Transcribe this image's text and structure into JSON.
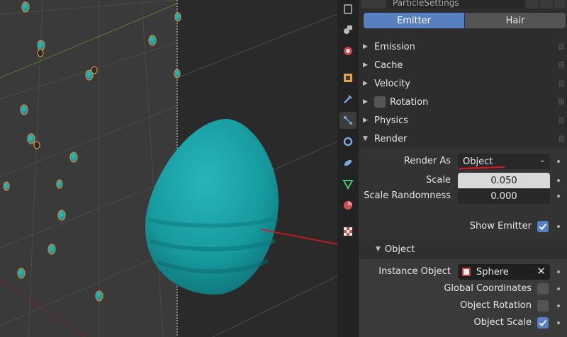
{
  "datablock": {
    "name": "ParticleSettings"
  },
  "mode_tabs": [
    {
      "label": "Emitter",
      "active": true
    },
    {
      "label": "Hair",
      "active": false
    }
  ],
  "panels": [
    {
      "label": "Emission",
      "expanded": false
    },
    {
      "label": "Cache",
      "expanded": false
    },
    {
      "label": "Velocity",
      "expanded": false
    },
    {
      "label": "Rotation",
      "expanded": false,
      "has_checkbox": true,
      "checked": false
    },
    {
      "label": "Physics",
      "expanded": false
    },
    {
      "label": "Render",
      "expanded": true
    }
  ],
  "render": {
    "render_as_label": "Render As",
    "render_as_value": "Object",
    "scale_label": "Scale",
    "scale_value": "0.050",
    "scale_random_label": "Scale Randomness",
    "scale_random_value": "0.000",
    "show_emitter_label": "Show Emitter",
    "show_emitter_checked": true
  },
  "object_subpanel": {
    "label": "Object",
    "instance_label": "Instance Object",
    "instance_value": "Sphere",
    "global_coords_label": "Global Coordinates",
    "global_coords_checked": false,
    "object_rotation_label": "Object Rotation",
    "object_rotation_checked": false,
    "object_scale_label": "Object Scale",
    "object_scale_checked": true
  },
  "sidebar_tabs": [
    "tool-icon",
    "render-icon",
    "output-icon",
    "object-icon",
    "modifier-icon",
    "particles-icon",
    "physics-icon",
    "constraints-icon",
    "object-data-icon",
    "material-icon",
    "texture-icon"
  ],
  "colors": {
    "accent": "#5680c2",
    "teal": "#1fa3a6",
    "annotation": "#e0141a"
  }
}
